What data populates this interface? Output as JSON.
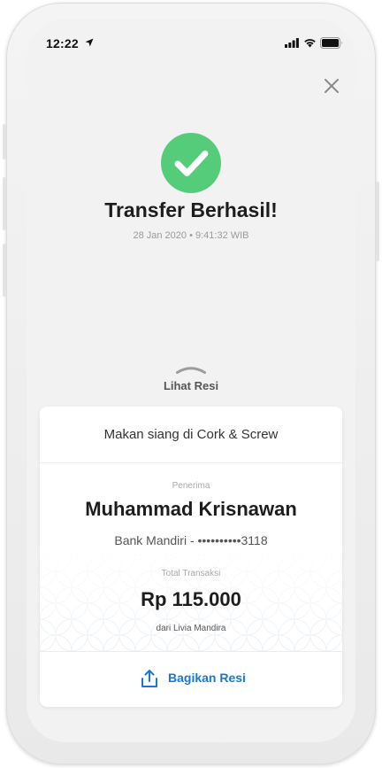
{
  "status_bar": {
    "time": "12:22"
  },
  "success": {
    "title": "Transfer Berhasil!",
    "timestamp": "28 Jan 2020 • 9:41:32 WIB"
  },
  "receipt_toggle": {
    "label": "Lihat Resi"
  },
  "receipt": {
    "note": "Makan siang di Cork & Screw",
    "recipient_label": "Penerima",
    "recipient_name": "Muhammad Krisnawan",
    "bank_account": "Bank Mandiri - ••••••••••3118",
    "total_label": "Total Transaksi",
    "total_amount": "Rp 115.000",
    "sender": "dari Livia Mandira",
    "share_label": "Bagikan Resi"
  },
  "colors": {
    "success_green": "#55cc7a",
    "accent_blue": "#1877d6",
    "screen_bg": "#f2f2f2"
  },
  "icons": [
    "location-arrow-icon",
    "signal-icon",
    "wifi-icon",
    "battery-icon",
    "close-icon",
    "check-icon",
    "chevron-up-icon",
    "share-icon"
  ]
}
